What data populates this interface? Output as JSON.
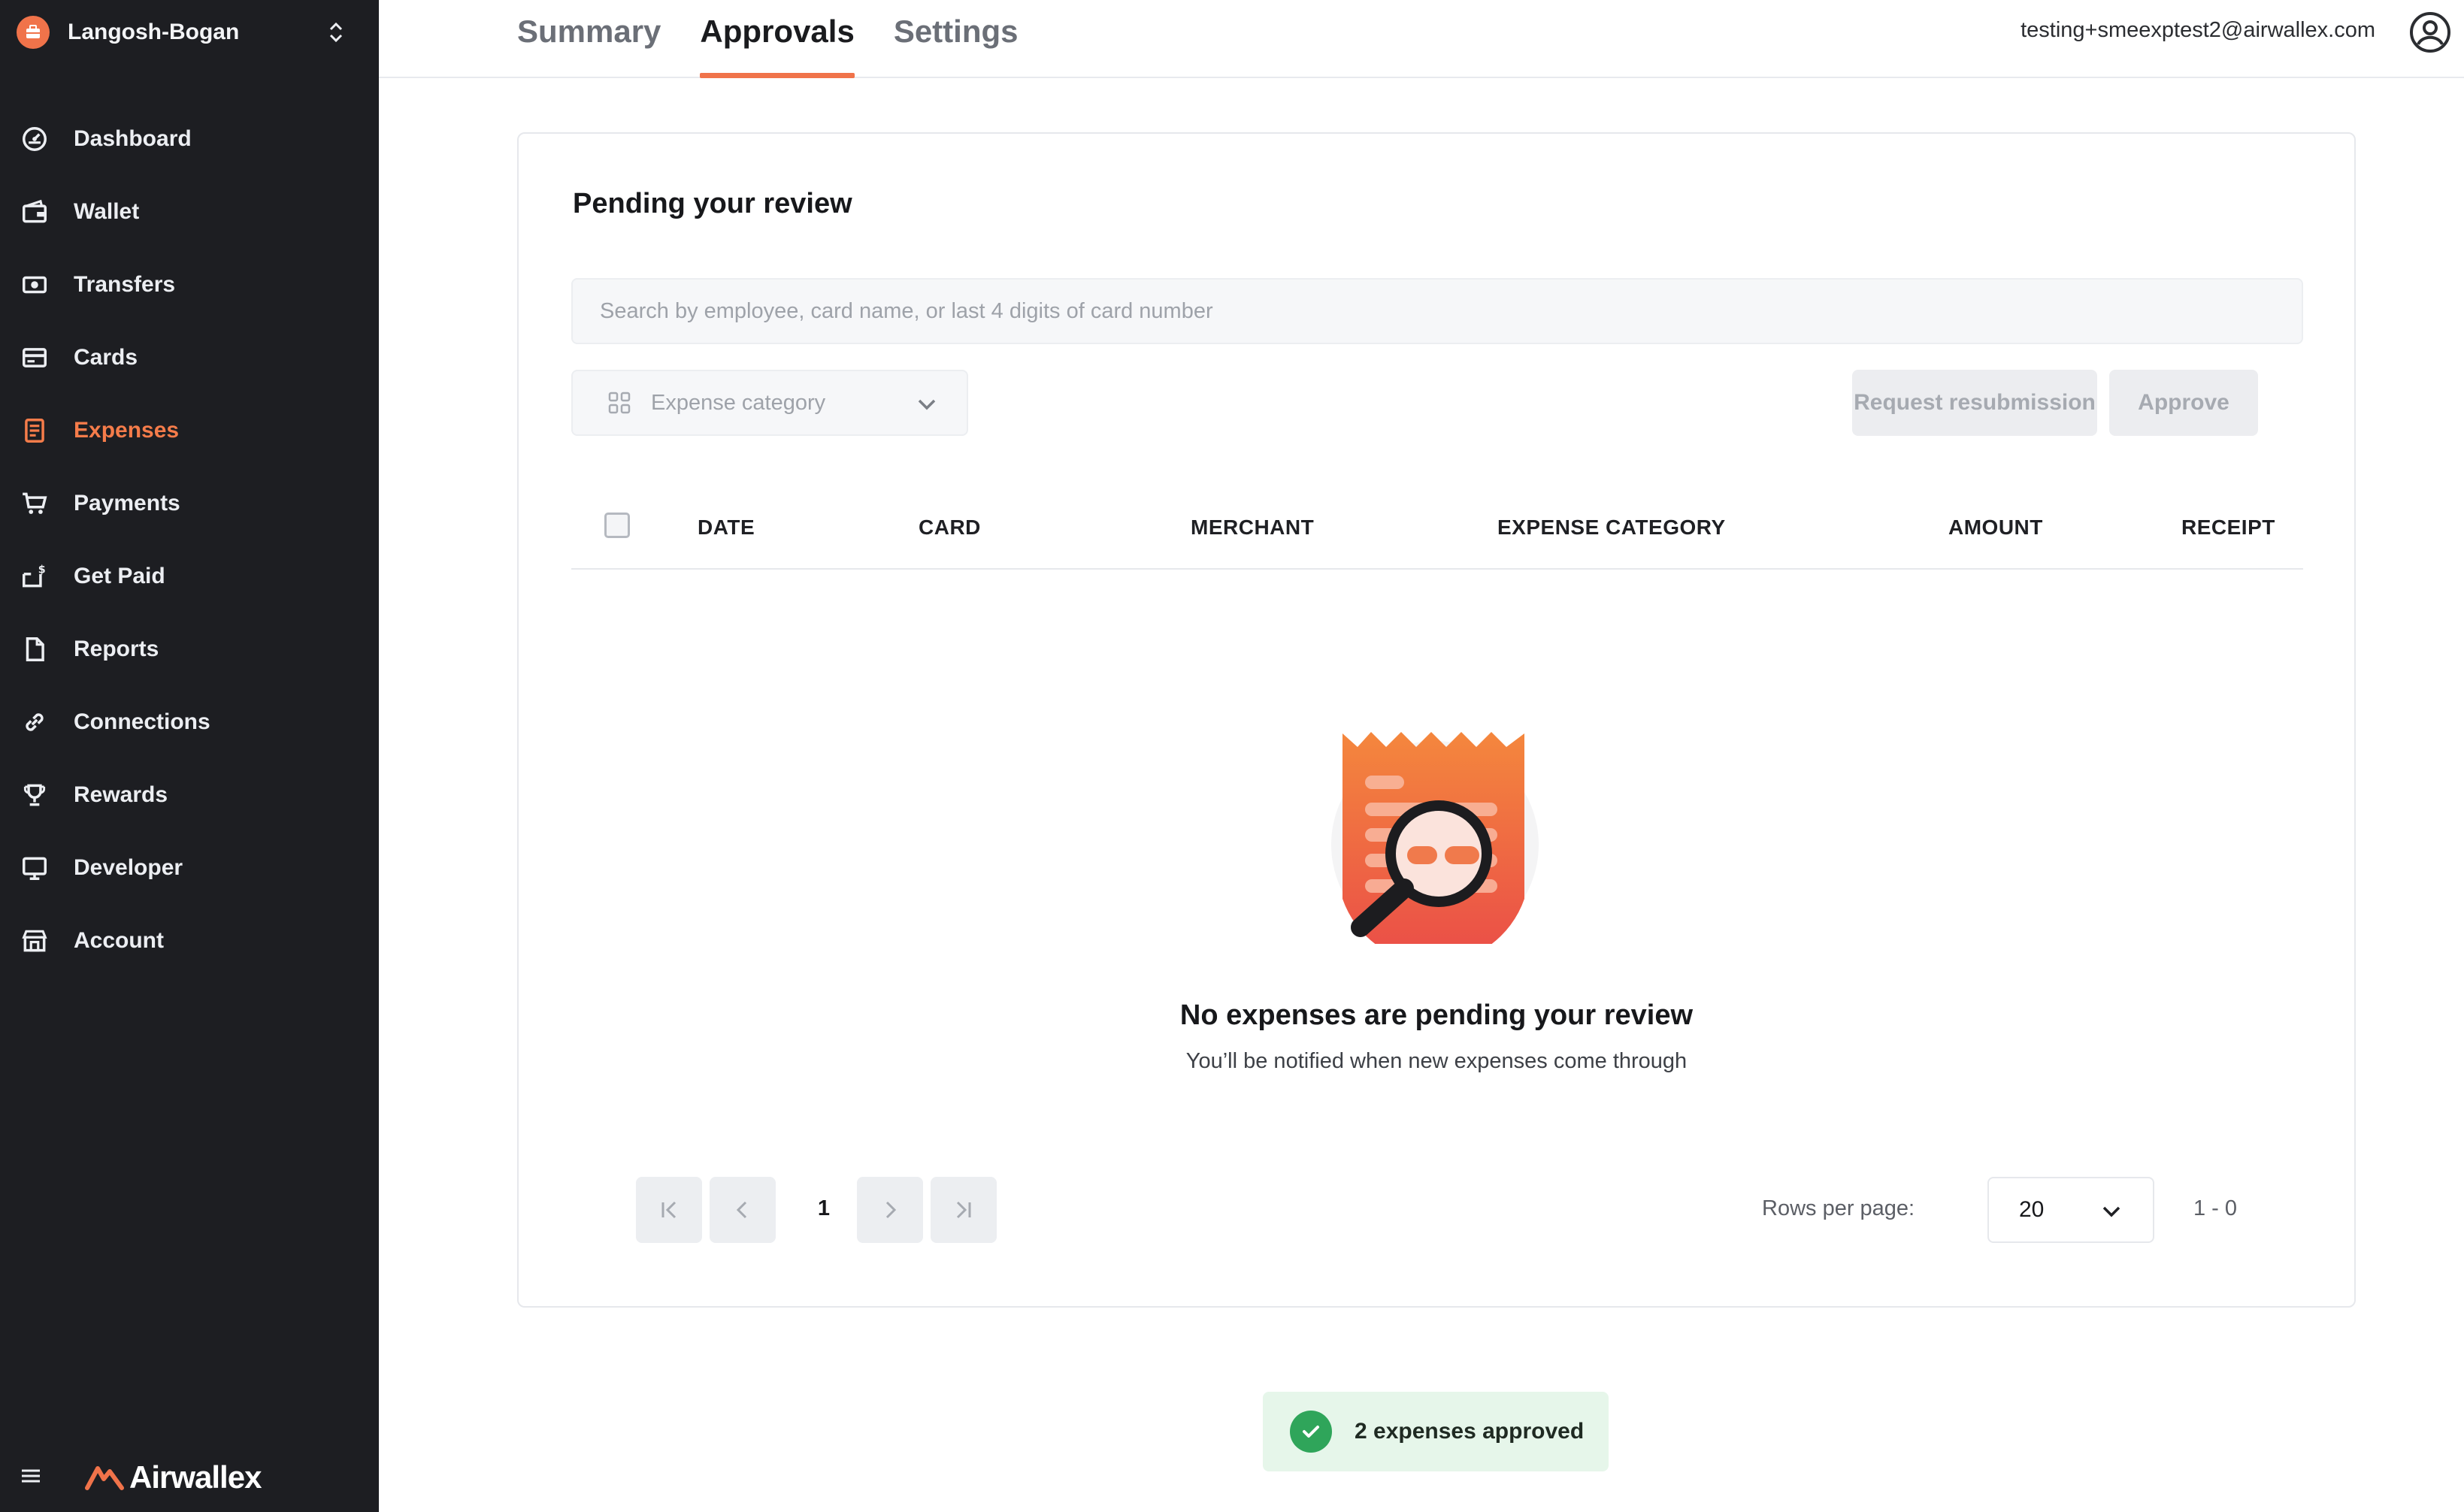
{
  "sidebar": {
    "org_name": "Langosh-Bogan",
    "items": [
      {
        "label": "Dashboard",
        "icon": "dashboard-icon"
      },
      {
        "label": "Wallet",
        "icon": "wallet-icon"
      },
      {
        "label": "Transfers",
        "icon": "transfers-icon"
      },
      {
        "label": "Cards",
        "icon": "cards-icon"
      },
      {
        "label": "Expenses",
        "icon": "expenses-icon",
        "active": true
      },
      {
        "label": "Payments",
        "icon": "cart-icon"
      },
      {
        "label": "Get Paid",
        "icon": "get-paid-icon"
      },
      {
        "label": "Reports",
        "icon": "document-icon"
      },
      {
        "label": "Connections",
        "icon": "link-icon"
      },
      {
        "label": "Rewards",
        "icon": "trophy-icon"
      },
      {
        "label": "Developer",
        "icon": "monitor-icon"
      },
      {
        "label": "Account",
        "icon": "store-icon"
      }
    ],
    "brand": "Airwallex"
  },
  "header": {
    "tabs": [
      {
        "label": "Summary"
      },
      {
        "label": "Approvals",
        "active": true
      },
      {
        "label": "Settings"
      }
    ],
    "user_email": "testing+smeexptest2@airwallex.com"
  },
  "main": {
    "title": "Pending your review",
    "search_placeholder": "Search by employee, card name, or last 4 digits of card number",
    "filter_label": "Expense category",
    "request_resubmission": "Request resubmission",
    "approve": "Approve",
    "columns": [
      "DATE",
      "CARD",
      "MERCHANT",
      "EXPENSE CATEGORY",
      "AMOUNT",
      "RECEIPT"
    ],
    "empty_title": "No expenses are pending your review",
    "empty_subtitle": "You’ll be notified when new expenses come through",
    "pagination": {
      "current_page": "1",
      "rows_label": "Rows per page:",
      "rows_value": "20",
      "range": "1 - 0"
    }
  },
  "toast": {
    "text": "2 expenses approved"
  },
  "colors": {
    "accent": "#f0734a",
    "sidebar_bg": "#1d1e22",
    "success": "#2fa55a"
  }
}
